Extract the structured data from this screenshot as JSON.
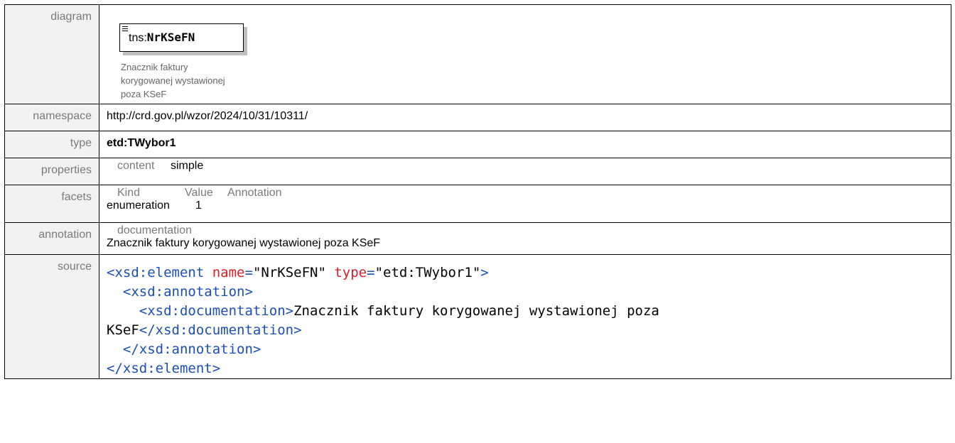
{
  "labels": {
    "diagram": "diagram",
    "namespace": "namespace",
    "type": "type",
    "properties": "properties",
    "facets": "facets",
    "annotation": "annotation",
    "source": "source"
  },
  "diagram": {
    "prefix": "tns:",
    "name": "NrKSeFN",
    "doc_lines": [
      "Znacznik faktury",
      "korygowanej wystawionej",
      "poza KSeF"
    ]
  },
  "namespace": "http://crd.gov.pl/wzor/2024/10/31/10311/",
  "type": "etd:TWybor1",
  "properties": {
    "key": "content",
    "value": "simple"
  },
  "facets": {
    "headers": [
      "Kind",
      "Value",
      "Annotation"
    ],
    "rows": [
      {
        "kind": "enumeration",
        "value": "1",
        "annotation": ""
      }
    ]
  },
  "annotation": {
    "key": "documentation",
    "text": "Znacznik faktury korygowanej wystawionej poza KSeF"
  },
  "source": {
    "l1_open": "<xsd:element",
    "l1_attr1": "name",
    "l1_eq1": "=",
    "l1_val1": "\"NrKSeFN\"",
    "l1_attr2": "type",
    "l1_eq2": "=",
    "l1_val2": "\"etd:TWybor1\"",
    "l1_close": ">",
    "l2": "<xsd:annotation>",
    "l3_open": "<xsd:documentation>",
    "l3_text": "Znacznik faktury korygowanej wystawionej poza",
    "l4_text": "KSeF",
    "l4_close": "</xsd:documentation>",
    "l5": "</xsd:annotation>",
    "l6": "</xsd:element>"
  }
}
